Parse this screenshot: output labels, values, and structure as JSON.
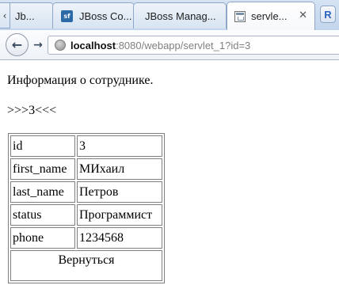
{
  "browser": {
    "tabs": [
      {
        "label": "Jb..."
      },
      {
        "label": "JBoss Co..."
      },
      {
        "label": "JBoss Manag..."
      },
      {
        "label": "servle..."
      }
    ],
    "active_tab_index": 3,
    "favicon_sf_text": "sf",
    "new_tab_glyph": "R",
    "url_host": "localhost",
    "url_rest": ":8080/webapp/servlet_1?id=3"
  },
  "page": {
    "info_text": "Информация о сотруднике.",
    "marker_text": ">>>3<<<",
    "rows": [
      {
        "key": "id",
        "value": "3"
      },
      {
        "key": "first_name",
        "value": "МИхаил"
      },
      {
        "key": "last_name",
        "value": "Петров"
      },
      {
        "key": "status",
        "value": "Программист"
      },
      {
        "key": "phone",
        "value": "1234568"
      }
    ],
    "back_button_label": "Вернуться"
  }
}
